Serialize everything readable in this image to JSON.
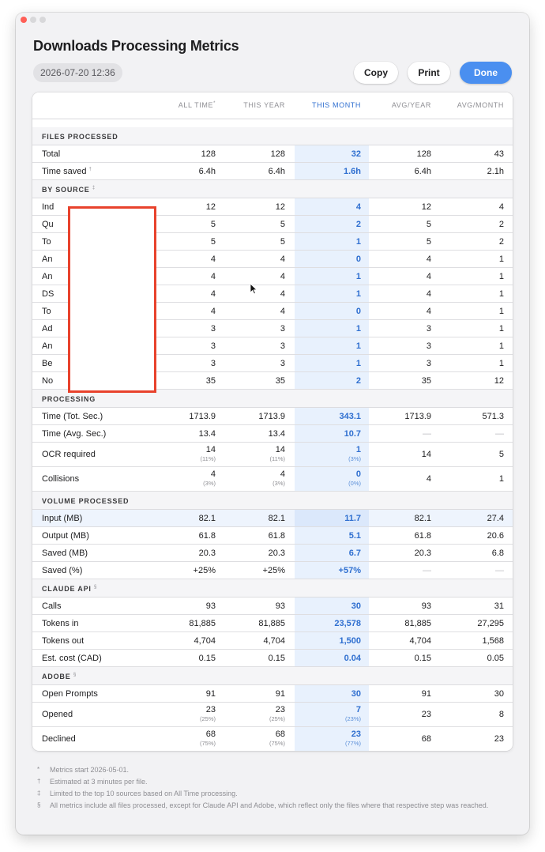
{
  "window": {
    "title": "Downloads Processing Metrics",
    "timestamp": "2026-07-20 12:36"
  },
  "toolbar": {
    "copy_label": "Copy",
    "print_label": "Print",
    "done_label": "Done"
  },
  "columns": [
    "ALL TIME",
    "THIS YEAR",
    "THIS MONTH",
    "AVG/YEAR",
    "AVG/MONTH"
  ],
  "column_marks": {
    "all_time": "*"
  },
  "highlight_color": "#2f6fd0",
  "sections": {
    "files": {
      "title": "FILES PROCESSED",
      "rows": [
        {
          "label": "Total",
          "mark": "",
          "values": [
            "128",
            "128",
            "32",
            "128",
            "43"
          ]
        },
        {
          "label": "Time saved",
          "mark": "†",
          "values": [
            "6.4h",
            "6.4h",
            "1.6h",
            "6.4h",
            "2.1h"
          ]
        }
      ]
    },
    "source": {
      "title": "BY SOURCE",
      "mark": "‡",
      "rows": [
        {
          "label": "Ind",
          "values": [
            "12",
            "12",
            "4",
            "12",
            "4"
          ]
        },
        {
          "label": "Qu",
          "values": [
            "5",
            "5",
            "2",
            "5",
            "2"
          ]
        },
        {
          "label": "To",
          "values": [
            "5",
            "5",
            "1",
            "5",
            "2"
          ]
        },
        {
          "label": "An",
          "values": [
            "4",
            "4",
            "0",
            "4",
            "1"
          ]
        },
        {
          "label": "An",
          "values": [
            "4",
            "4",
            "1",
            "4",
            "1"
          ]
        },
        {
          "label": "DS",
          "values": [
            "4",
            "4",
            "1",
            "4",
            "1"
          ]
        },
        {
          "label": "To",
          "values": [
            "4",
            "4",
            "0",
            "4",
            "1"
          ]
        },
        {
          "label": "Ad",
          "values": [
            "3",
            "3",
            "1",
            "3",
            "1"
          ]
        },
        {
          "label": "An",
          "values": [
            "3",
            "3",
            "1",
            "3",
            "1"
          ]
        },
        {
          "label": "Be",
          "values": [
            "3",
            "3",
            "1",
            "3",
            "1"
          ]
        },
        {
          "label": "No",
          "values": [
            "35",
            "35",
            "2",
            "35",
            "12"
          ]
        }
      ]
    },
    "processing": {
      "title": "PROCESSING",
      "rows": [
        {
          "label": "Time (Tot. Sec.)",
          "values": [
            "1713.9",
            "1713.9",
            "343.1",
            "1713.9",
            "571.3"
          ]
        },
        {
          "label": "Time (Avg. Sec.)",
          "values": [
            "13.4",
            "13.4",
            "10.7",
            "—",
            "—"
          ]
        }
      ],
      "ocr": {
        "label": "OCR required",
        "values": [
          "14",
          "14",
          "1",
          "14",
          "5"
        ],
        "pcts": [
          "(11%)",
          "(11%)",
          "(3%)"
        ]
      },
      "collisions": {
        "label": "Collisions",
        "values": [
          "4",
          "4",
          "0",
          "4",
          "1"
        ],
        "pcts": [
          "(3%)",
          "(3%)",
          "(0%)"
        ]
      }
    },
    "volume": {
      "title": "VOLUME PROCESSED",
      "rows": [
        {
          "label": "Input (MB)",
          "values": [
            "82.1",
            "82.1",
            "11.7",
            "82.1",
            "27.4"
          ]
        },
        {
          "label": "Output (MB)",
          "values": [
            "61.8",
            "61.8",
            "5.1",
            "61.8",
            "20.6"
          ]
        },
        {
          "label": "Saved (MB)",
          "values": [
            "20.3",
            "20.3",
            "6.7",
            "20.3",
            "6.8"
          ]
        },
        {
          "label": "Saved (%)",
          "values": [
            "+25%",
            "+25%",
            "+57%",
            "—",
            "—"
          ]
        }
      ]
    },
    "claude": {
      "title": "CLAUDE API",
      "mark": "§",
      "rows": [
        {
          "label": "Calls",
          "values": [
            "93",
            "93",
            "30",
            "93",
            "31"
          ]
        },
        {
          "label": "Tokens in",
          "values": [
            "81,885",
            "81,885",
            "23,578",
            "81,885",
            "27,295"
          ]
        },
        {
          "label": "Tokens out",
          "values": [
            "4,704",
            "4,704",
            "1,500",
            "4,704",
            "1,568"
          ]
        },
        {
          "label": "Est. cost (CAD)",
          "values": [
            "0.15",
            "0.15",
            "0.04",
            "0.15",
            "0.05"
          ]
        }
      ]
    },
    "adobe": {
      "title": "ADOBE",
      "mark": "§",
      "open": {
        "label": "Open Prompts",
        "values": [
          "91",
          "91",
          "30",
          "91",
          "30"
        ]
      },
      "opened": {
        "label": "Opened",
        "values": [
          "23",
          "23",
          "7",
          "23",
          "8"
        ],
        "pcts": [
          "(25%)",
          "(25%)",
          "(23%)"
        ]
      },
      "declined": {
        "label": "Declined",
        "values": [
          "68",
          "68",
          "23",
          "68",
          "23"
        ],
        "pcts": [
          "(75%)",
          "(75%)",
          "(77%)"
        ]
      }
    }
  },
  "footnotes": [
    {
      "mark": "*",
      "text": "Metrics start 2026-05-01."
    },
    {
      "mark": "†",
      "text": "Estimated at 3 minutes per file."
    },
    {
      "mark": "‡",
      "text": "Limited to the top 10 sources based on All Time processing."
    },
    {
      "mark": "§",
      "text": "All metrics include all files processed, except for Claude API and Adobe, which reflect only the files where that respective step was reached."
    }
  ]
}
